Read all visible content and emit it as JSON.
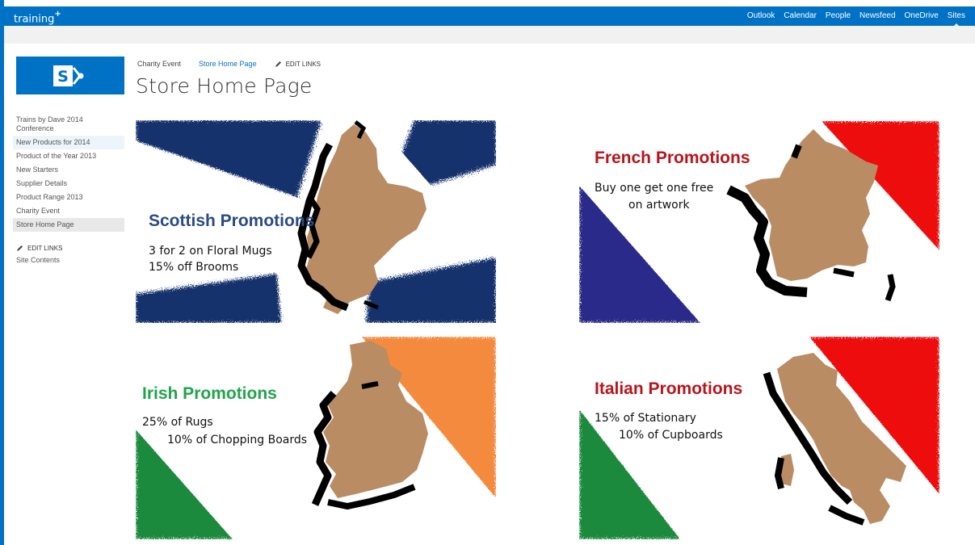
{
  "colors": {
    "suite_blue": "#0072c6",
    "map_tan": "#b98c64",
    "scotland_blue": "#16306d",
    "france_blue": "#2a2a8a",
    "france_red": "#ee1111",
    "ireland_green": "#1e8a3c",
    "ireland_orange": "#f48a3c",
    "italy_green": "#1e8a3c",
    "italy_red": "#ee1111",
    "scottish_heading": "#2a4a86",
    "french_heading": "#b8141c",
    "irish_heading": "#1fa44a",
    "italian_heading": "#b8141c"
  },
  "suitebar": {
    "brand": "training",
    "brand_mark": "+",
    "links": [
      "Outlook",
      "Calendar",
      "People",
      "Newsfeed",
      "OneDrive",
      "Sites"
    ]
  },
  "logo": {
    "letter": "S",
    "icon": "sharepoint-logo-icon"
  },
  "breadcrumb": {
    "site": "Charity Event",
    "current": "Store Home Page",
    "edit_links": "EDIT LINKS"
  },
  "page_title": "Store Home Page",
  "leftnav": {
    "items": [
      "Trains by Dave 2014 Conference",
      "New Products for 2014",
      "Product of the Year 2013",
      "New Starters",
      "Supplier Details",
      "Product Range 2013",
      "Charity Event",
      "Store Home Page"
    ],
    "edit_links": "EDIT LINKS",
    "site_contents": "Site Contents"
  },
  "promotions": {
    "scottish": {
      "heading": "Scottish Promotions",
      "line1": "3 for 2 on Floral Mugs",
      "line2": "15% off Brooms"
    },
    "french": {
      "heading": "French Promotions",
      "line1": "Buy one get one free",
      "line2": "on artwork"
    },
    "irish": {
      "heading": "Irish Promotions",
      "line1": "25% of Rugs",
      "line2": "10% of Chopping Boards"
    },
    "italian": {
      "heading": "Italian Promotions",
      "line1": "15% of Stationary",
      "line2": "10% of Cupboards"
    }
  }
}
